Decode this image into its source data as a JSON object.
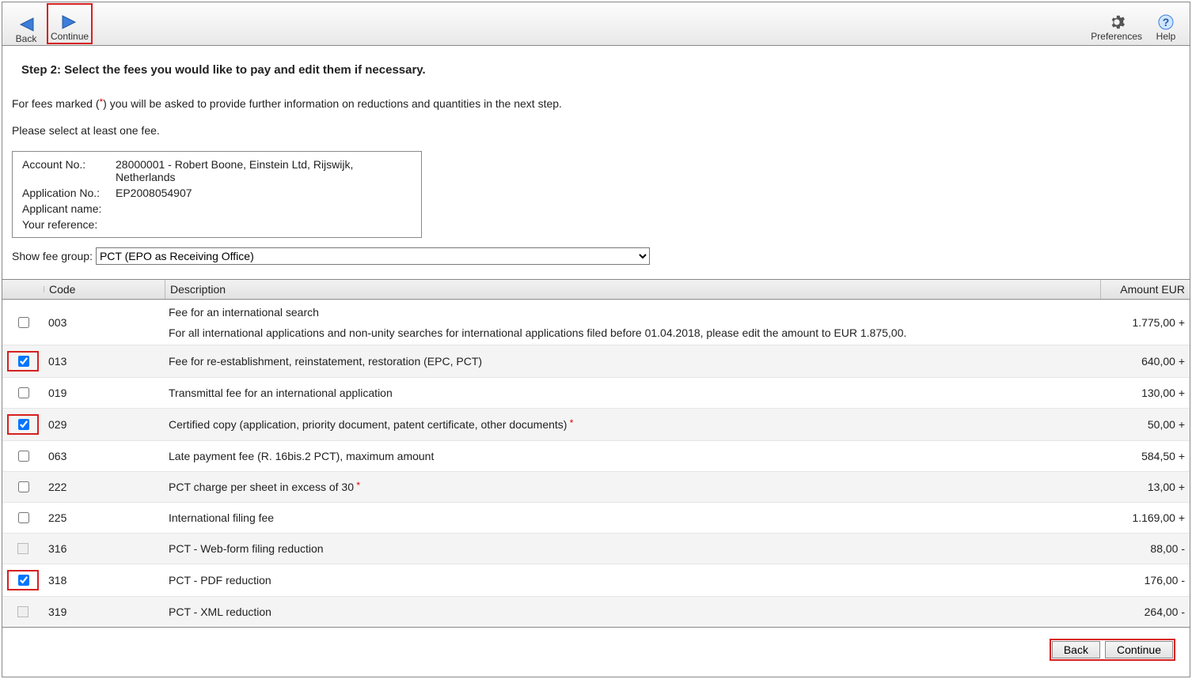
{
  "toolbar": {
    "back_label": "Back",
    "continue_label": "Continue",
    "preferences_label": "Preferences",
    "help_label": "Help"
  },
  "step_title": "Step 2: Select the fees you would like to pay and edit them if necessary.",
  "intro_prefix": "For fees marked (",
  "intro_star": "*",
  "intro_suffix": ") you will be asked to provide further information on reductions and quantities in the next step.",
  "select_hint": "Please select at least one fee.",
  "info": {
    "account_no_label": "Account No.:",
    "account_no_value": "28000001 - Robert Boone, Einstein Ltd, Rijswijk, Netherlands",
    "application_no_label": "Application No.:",
    "application_no_value": "EP2008054907",
    "applicant_name_label": "Applicant name:",
    "applicant_name_value": "",
    "your_reference_label": "Your reference:",
    "your_reference_value": ""
  },
  "fee_group_label": "Show fee group:",
  "fee_group_selected": "PCT (EPO as Receiving Office)",
  "table": {
    "col_code": "Code",
    "col_desc": "Description",
    "col_amt": "Amount  EUR"
  },
  "fees": [
    {
      "code": "003",
      "desc": "Fee for an international search",
      "desc2": "For all international applications and non-unity searches for international applications filed before 01.04.2018, please edit the amount to EUR 1.875,00.",
      "amount": "1.775,00 +",
      "checked": false,
      "star": false,
      "disabled": false,
      "highlight": false
    },
    {
      "code": "013",
      "desc": "Fee for re-establishment, reinstatement, restoration (EPC, PCT)",
      "amount": "640,00 +",
      "checked": true,
      "star": false,
      "disabled": false,
      "highlight": true
    },
    {
      "code": "019",
      "desc": "Transmittal fee for an international application",
      "amount": "130,00 +",
      "checked": false,
      "star": false,
      "disabled": false,
      "highlight": false
    },
    {
      "code": "029",
      "desc": "Certified copy (application, priority document, patent certificate, other documents)",
      "amount": "50,00 +",
      "checked": true,
      "star": true,
      "disabled": false,
      "highlight": true
    },
    {
      "code": "063",
      "desc": "Late payment fee (R. 16bis.2 PCT), maximum amount",
      "amount": "584,50 +",
      "checked": false,
      "star": false,
      "disabled": false,
      "highlight": false
    },
    {
      "code": "222",
      "desc": "PCT charge per sheet in excess of 30",
      "amount": "13,00 +",
      "checked": false,
      "star": true,
      "disabled": false,
      "highlight": false
    },
    {
      "code": "225",
      "desc": "International filing fee",
      "amount": "1.169,00 +",
      "checked": false,
      "star": false,
      "disabled": false,
      "highlight": false
    },
    {
      "code": "316",
      "desc": "PCT - Web-form filing reduction",
      "amount": "88,00 -",
      "checked": false,
      "star": false,
      "disabled": true,
      "highlight": false
    },
    {
      "code": "318",
      "desc": "PCT - PDF reduction",
      "amount": "176,00 -",
      "checked": true,
      "star": false,
      "disabled": false,
      "highlight": true
    },
    {
      "code": "319",
      "desc": "PCT - XML reduction",
      "amount": "264,00 -",
      "checked": false,
      "star": false,
      "disabled": true,
      "highlight": false
    }
  ],
  "footer": {
    "back_label": "Back",
    "continue_label": "Continue"
  }
}
